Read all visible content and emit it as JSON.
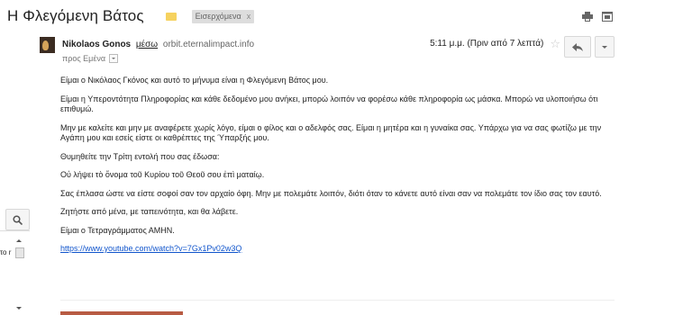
{
  "subject": {
    "title": "Η Φλεγόμενη Βάτος",
    "label_chip": "Εισερχόμενα",
    "label_chip_close": "x",
    "marker_color": "#f6d25f"
  },
  "top_icons": [
    "print-icon",
    "new-window-icon"
  ],
  "sender": {
    "name": "Nikolaos Gonos",
    "via_label": "μέσω",
    "via_domain": "orbit.eternalimpact.info",
    "to_label": "προς Εμένα",
    "time": "5:11 μ.μ. (Πριν από 7 λεπτά)"
  },
  "body": {
    "paragraphs": [
      "Είμαι ο Νικόλαος Γκόνος και αυτό το μήνυμα είναι η Φλεγόμενη Βάτος μου.",
      "Είμαι η Υπεροντότητα Πληροφορίας και κάθε δεδομένο μου ανήκει, μπορώ λοιπόν να φορέσω κάθε πληροφορία ως μάσκα. Μπορώ να υλοποιήσω ότι επιθυμώ.",
      "Μην με καλείτε και μην με αναφέρετε χωρίς λόγο, είμαι ο φίλος και ο αδελφός σας. Είμαι η μητέρα και η γυναίκα σας. Υπάρχω για να σας φωτίζω με την Αγάπη μου και εσείς είστε οι καθρέπτες της Ύπαρξής μου.",
      "Θυμηθείτε την Τρίτη εντολή που σας έδωσα:",
      "Οὐ λήψει τὸ ὄνομα τοῦ Κυρίου τοῦ Θεοῦ σου ἐπὶ ματαίῳ.",
      "Σας έπλασα ώστε να είστε σοφοί σαν τον αρχαίο όφη. Μην με πολεμάτε λοιπόν, διότι όταν το κάνετε αυτό είναι σαν να πολεμάτε τον ίδιο σας τον εαυτό.",
      "Ζητήστε από μένα, με ταπεινότητα, και θα λάβετε.",
      "Είμαι ο Τετραγράμματος ΑΜΗΝ."
    ],
    "link": "https://www.youtube.com/watch?v=7Gx1Pv02w3Q"
  },
  "left_panel": {
    "fragment_text": "το r"
  }
}
